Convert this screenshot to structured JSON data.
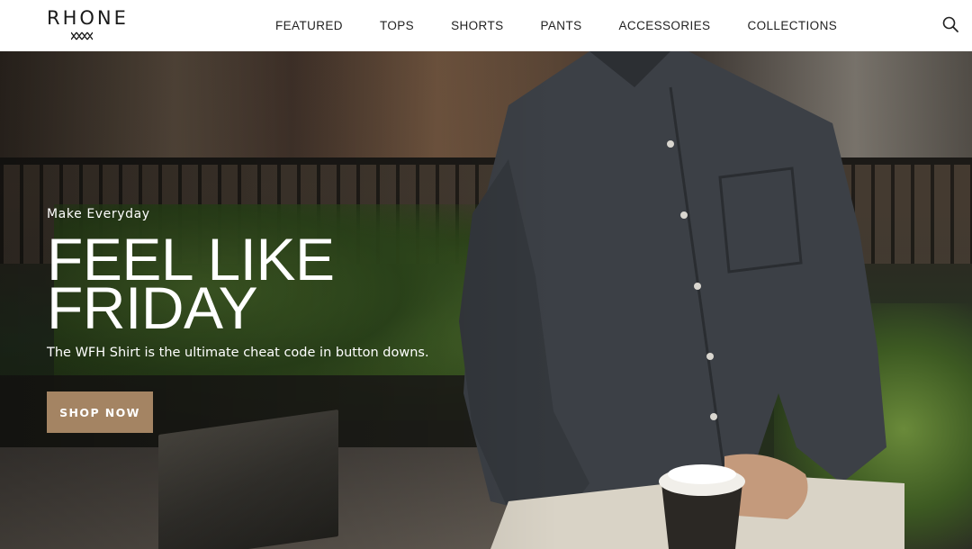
{
  "brand": {
    "name": "RHONE"
  },
  "nav": {
    "items": [
      {
        "label": "FEATURED"
      },
      {
        "label": "TOPS"
      },
      {
        "label": "SHORTS"
      },
      {
        "label": "PANTS"
      },
      {
        "label": "ACCESSORIES"
      },
      {
        "label": "COLLECTIONS"
      }
    ],
    "search_icon": "search-icon"
  },
  "hero": {
    "eyebrow": "Make Everyday",
    "headline_line1": "FEEL LIKE",
    "headline_line2": "FRIDAY",
    "subhead": "The WFH Shirt is the ultimate cheat code in button downs.",
    "cta_label": "SHOP NOW"
  },
  "colors": {
    "cta_background": "#a48463",
    "header_background": "#ffffff",
    "hero_text": "#ffffff",
    "nav_text": "#222222"
  }
}
